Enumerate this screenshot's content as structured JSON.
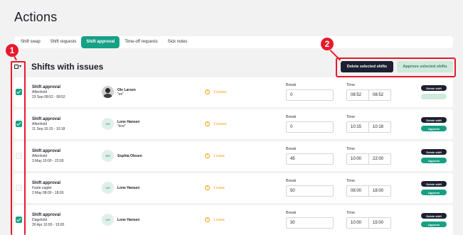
{
  "page": {
    "title": "Actions"
  },
  "tabs": [
    {
      "label": "Shift swap",
      "active": false
    },
    {
      "label": "Shift requests",
      "active": false
    },
    {
      "label": "Shift approval",
      "active": true
    },
    {
      "label": "Time-off requests",
      "active": false
    },
    {
      "label": "Sick notes",
      "active": false
    }
  ],
  "section": {
    "title": "Shifts with issues",
    "select_all_icon": "select-all-checkbox-icon"
  },
  "actions": {
    "delete_selected": "Delete selected shifts",
    "approve_selected": "Approve selected shifts"
  },
  "labels": {
    "break": "Break",
    "time": "Time",
    "delete_shift": "Delete shift",
    "approve": "Approve"
  },
  "rows": [
    {
      "checked": true,
      "title": "Shift approval",
      "type": "Aftenhold",
      "date": "23 Sep 08:52 - 08:52",
      "avatar": "",
      "avatar_photo": true,
      "name": "Ole Larsen",
      "comment": "\"ee\"",
      "issues": "3 issues",
      "break": "0",
      "start": "08:52",
      "end": "08:52",
      "approve_enabled": false
    },
    {
      "checked": true,
      "title": "Shift approval",
      "type": "Aftenhold",
      "date": "11 Sep 10:15 - 10:18",
      "avatar": "LH",
      "avatar_photo": false,
      "name": "Lone Hansen",
      "comment": "\"test\"",
      "issues": "3 issues",
      "break": "0",
      "start": "10:15",
      "end": "10:18",
      "approve_enabled": true
    },
    {
      "checked": false,
      "title": "Shift approval",
      "type": "Aftenhold",
      "date": "3 May 10:00 - 22:00",
      "avatar": "SO",
      "avatar_photo": false,
      "name": "Sophia Olesen",
      "comment": "",
      "issues": "1 issue",
      "break": "45",
      "start": "10:00",
      "end": "22:00",
      "approve_enabled": true
    },
    {
      "checked": false,
      "title": "Shift approval",
      "type": "Faste vagter",
      "date": "2 May 08:00 - 18:00",
      "avatar": "LH",
      "avatar_photo": false,
      "name": "Lone Hansen",
      "comment": "",
      "issues": "1 issue",
      "break": "50",
      "start": "08:00",
      "end": "18:00",
      "approve_enabled": true
    },
    {
      "checked": true,
      "title": "Shift approval",
      "type": "Dagshold",
      "date": "30 Apr 10:00 - 15:00",
      "avatar": "LH",
      "avatar_photo": false,
      "name": "Lone Hansen",
      "comment": "",
      "issues": "1 issue",
      "break": "30",
      "start": "10:00",
      "end": "15:00",
      "approve_enabled": true
    }
  ],
  "annotations": [
    {
      "number": "1",
      "target": "checkbox column"
    },
    {
      "number": "2",
      "target": "bulk action buttons"
    }
  ],
  "colors": {
    "accent": "#16a085",
    "dark": "#1c2030",
    "warning": "#f39c12",
    "annotation": "#e8192c"
  }
}
